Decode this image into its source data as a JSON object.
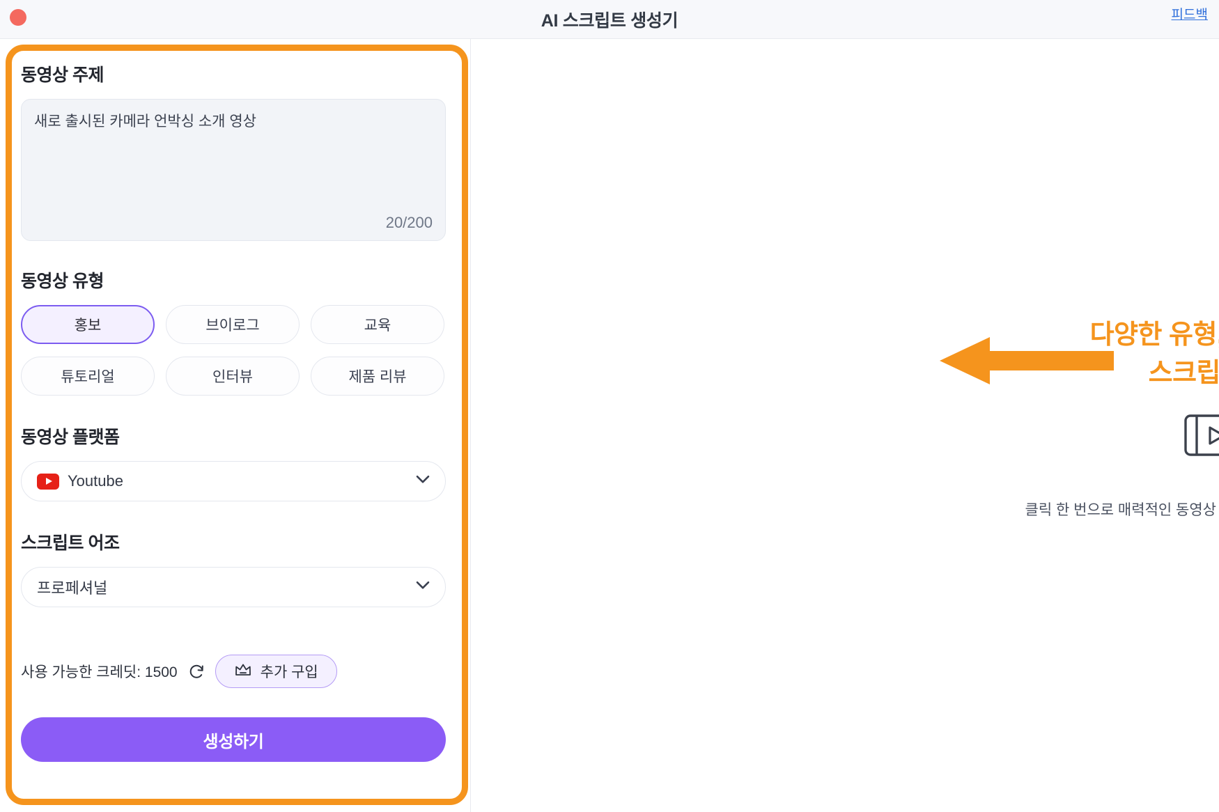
{
  "window": {
    "title": "AI 스크립트 생성기",
    "close_button_color": "#f4695f",
    "feedback_label": "피드백",
    "feedback_color": "#2f6fdb"
  },
  "form": {
    "topic": {
      "label": "동영상 주제",
      "value": "새로 출시된 카메라 언박싱 소개 영상",
      "counter": "20/200"
    },
    "video_type": {
      "label": "동영상 유형",
      "options": [
        {
          "label": "홍보",
          "selected": true
        },
        {
          "label": "브이로그",
          "selected": false
        },
        {
          "label": "교육",
          "selected": false
        },
        {
          "label": "튜토리얼",
          "selected": false
        },
        {
          "label": "인터뷰",
          "selected": false
        },
        {
          "label": "제품 리뷰",
          "selected": false
        }
      ]
    },
    "platform": {
      "label": "동영상 플랫폼",
      "selected": "Youtube",
      "icon": "youtube-icon"
    },
    "tone": {
      "label": "스크립트 어조",
      "selected": "프로페셔널"
    },
    "credits": {
      "text": "사용 가능한 크레딧: 1500",
      "amount": "1500",
      "refresh_icon": "refresh-icon",
      "buy_label": "추가 구입",
      "buy_icon": "crown-icon"
    },
    "generate_label": "생성하기"
  },
  "annotation": {
    "line1": "다양한 유형, 플랫폼 및 어조에 맞춘",
    "line2": "스크립트 자동 생성 가능",
    "color": "#f5941d",
    "arrow_icon": "left-arrow-icon"
  },
  "empty_state": {
    "icon": "video-script-icon",
    "caption": "클릭 한 번으로 매력적인 동영상 스크립트가 여기에 표시됩니다."
  },
  "colors": {
    "accent_purple": "#8b5cf6",
    "highlight_orange": "#f5941d",
    "youtube_red": "#e62117"
  }
}
